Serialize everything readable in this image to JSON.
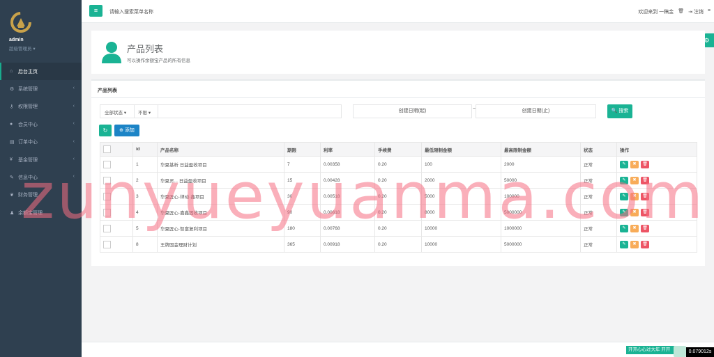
{
  "sidebar": {
    "admin_name": "admin",
    "admin_role": "超级管理员",
    "role_caret": "▾",
    "items": [
      {
        "label": "后台主页",
        "icon": "home-icon",
        "glyph": "⌂",
        "has_arrow": false
      },
      {
        "label": "系统管理",
        "icon": "gears-icon",
        "glyph": "⚙",
        "has_arrow": true
      },
      {
        "label": "权限管理",
        "icon": "key-icon",
        "glyph": "⚷",
        "has_arrow": true
      },
      {
        "label": "会员中心",
        "icon": "user-icon",
        "glyph": "●",
        "has_arrow": true
      },
      {
        "label": "订单中心",
        "icon": "list-icon",
        "glyph": "▤",
        "has_arrow": true
      },
      {
        "label": "基金管理",
        "icon": "yen-icon",
        "glyph": "¥",
        "has_arrow": true
      },
      {
        "label": "信息中心",
        "icon": "wrench-icon",
        "glyph": "✎",
        "has_arrow": true
      },
      {
        "label": "财务管理",
        "icon": "leaf-icon",
        "glyph": "❦",
        "has_arrow": false
      },
      {
        "label": "余额宝管理",
        "icon": "users-icon",
        "glyph": "♟",
        "has_arrow": false
      }
    ],
    "arrow_glyph": "‹"
  },
  "topbar": {
    "menu_glyph": "≡",
    "search_placeholder": "请输入搜索菜单名称",
    "welcome": "欢迎来到 一稿金",
    "trash_glyph": "🗑",
    "logout_glyph": "⇥",
    "logout_label": "注销",
    "menu_right_glyph": "≡"
  },
  "float_glyph": "⚙",
  "header": {
    "title": "产品列表",
    "subtitle": "可以操作余额宝产品的所有信息"
  },
  "panel": {
    "title": "产品列表",
    "status_filter": "全部状态",
    "limit_filter": "不限",
    "caret": "▾",
    "date_start": "创建日期(起)",
    "date_tilde": "~",
    "date_end": "创建日期(止)",
    "search_label": "搜索",
    "search_glyph": "🔍",
    "refresh_glyph": "↻",
    "add_glyph": "⊕",
    "add_label": "添加"
  },
  "table": {
    "headers": [
      "id",
      "产品名称",
      "期限",
      "利率",
      "手续费",
      "最低限制金额",
      "最高限制金额",
      "状态",
      "操作"
    ],
    "rows": [
      {
        "id": "1",
        "name": "华夏基析 日益盈收项目",
        "term": "7",
        "rate": "0.00358",
        "fee": "0.20",
        "min": "100",
        "max": "2000",
        "status": "正常"
      },
      {
        "id": "2",
        "name": "华夏灵... 日益盈收项目",
        "term": "15",
        "rate": "0.00428",
        "fee": "0.20",
        "min": "2000",
        "max": "50000",
        "status": "正常"
      },
      {
        "id": "3",
        "name": "华夏匠心·律动·鑫项目",
        "term": "30",
        "rate": "0.00518",
        "fee": "0.20",
        "min": "5000",
        "max": "100000",
        "status": "正常"
      },
      {
        "id": "4",
        "name": "华夏匠心·嘉鑫固收项目",
        "term": "90",
        "rate": "0.00618",
        "fee": "0.20",
        "min": "8000",
        "max": "5000000",
        "status": "正常"
      },
      {
        "id": "5",
        "name": "华夏匠心·智富复利项目",
        "term": "180",
        "rate": "0.00768",
        "fee": "0.20",
        "min": "10000",
        "max": "1000000",
        "status": "正常"
      },
      {
        "id": "8",
        "name": "王牌固金理财计划",
        "term": "365",
        "rate": "0.00918",
        "fee": "0.20",
        "min": "10000",
        "max": "5000000",
        "status": "正常"
      }
    ],
    "edit_glyph": "✎",
    "view_glyph": "✖",
    "delete_glyph": "🗑"
  },
  "footer": {
    "banner": "开开心心过大年 开开",
    "time": "0.079012s"
  },
  "watermark": "zunyueyuanma.com",
  "colors": {
    "accent": "#1ab394",
    "sidebar": "#2f4050",
    "primary": "#1c84c6",
    "warning": "#f8ac59",
    "danger": "#ed5565"
  }
}
